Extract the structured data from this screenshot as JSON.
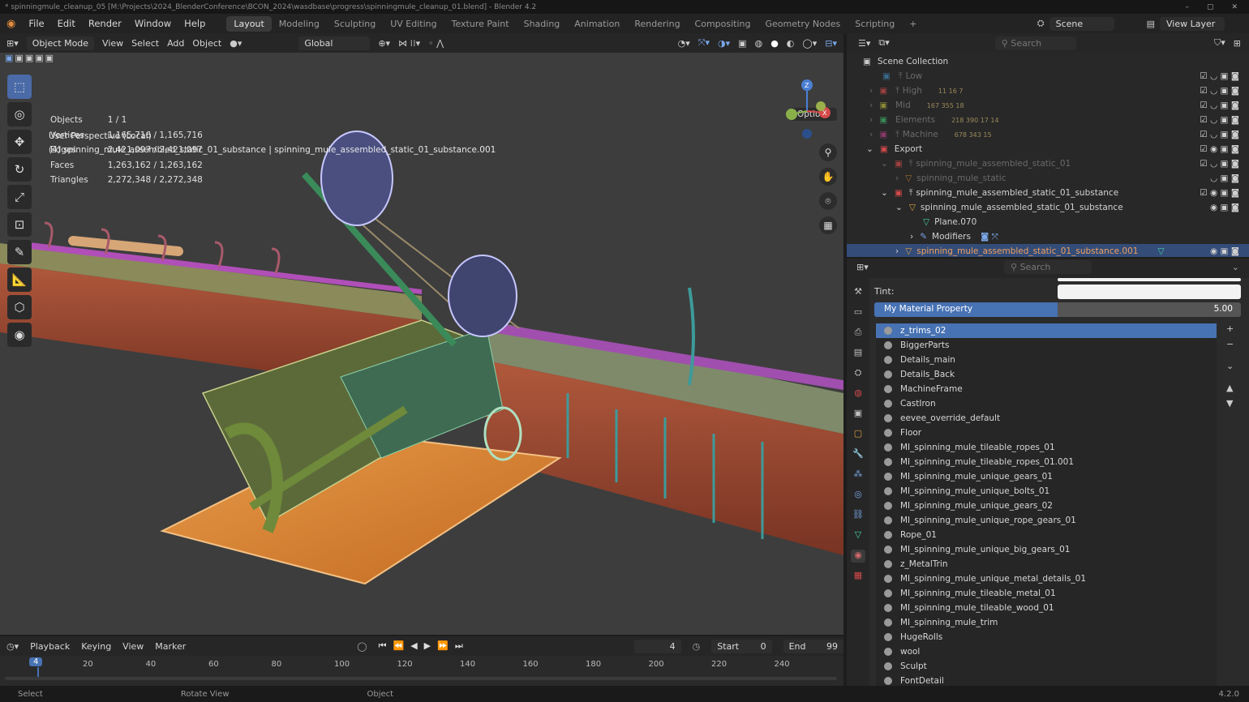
{
  "window": {
    "title": "* spinningmule_cleanup_05 [M:\\Projects\\2024_BlenderConference\\BCON_2024\\wasdbase\\progress\\spinningmule_cleanup_01.blend] - Blender 4.2"
  },
  "menu": [
    "File",
    "Edit",
    "Render",
    "Window",
    "Help"
  ],
  "workspaces": [
    "Layout",
    "Modeling",
    "Sculpting",
    "UV Editing",
    "Texture Paint",
    "Shading",
    "Animation",
    "Rendering",
    "Compositing",
    "Geometry Nodes",
    "Scripting"
  ],
  "active_workspace": "Layout",
  "scene": {
    "name": "Scene",
    "view_layer": "View Layer"
  },
  "viewport_header": {
    "mode": "Object Mode",
    "items": [
      "View",
      "Select",
      "Add",
      "Object"
    ],
    "transform": "Global"
  },
  "viewport": {
    "options": "Options",
    "perspective": "User Perspective (Local)",
    "object_line": "(4) spinning_mule_assembled_static_01_substance | spinning_mule_assembled_static_01_substance.001",
    "stats": [
      {
        "label": "Objects",
        "value": "1 / 1"
      },
      {
        "label": "Vertices",
        "value": "1,165,716 / 1,165,716"
      },
      {
        "label": "Edges",
        "value": "2,421,097 / 2,421,097"
      },
      {
        "label": "Faces",
        "value": "1,263,162 / 1,263,162"
      },
      {
        "label": "Triangles",
        "value": "2,272,348 / 2,272,348"
      }
    ]
  },
  "timeline": {
    "menus": [
      "Playback",
      "Keying",
      "View",
      "Marker"
    ],
    "current_frame": "4",
    "start_label": "Start",
    "start": "0",
    "end_label": "End",
    "end": "99",
    "ticks": [
      "20",
      "40",
      "60",
      "80",
      "100",
      "120",
      "140",
      "160",
      "180",
      "200",
      "220",
      "240"
    ],
    "frame_marker": "4"
  },
  "statusbar": {
    "items": [
      "Select",
      "Rotate View",
      "Object"
    ],
    "version": "4.2.0"
  },
  "outliner": {
    "search_placeholder": "Search",
    "root": "Scene Collection",
    "rows": [
      {
        "name": "Low",
        "extra": "",
        "dim": true
      },
      {
        "name": "High",
        "extra": "11 16 7",
        "dim": true
      },
      {
        "name": "Mid",
        "extra": "167 355 18",
        "dim": true
      },
      {
        "name": "Elements",
        "extra": "218 390 17 14",
        "dim": true
      },
      {
        "name": "Machine",
        "extra": "678 343 15",
        "dim": true
      },
      {
        "name": "Export",
        "extra": "",
        "dim": false
      },
      {
        "name": "spinning_mule_assembled_static_01",
        "extra": "",
        "dim": true
      },
      {
        "name": "spinning_mule_static",
        "extra": "",
        "dim": true
      },
      {
        "name": "spinning_mule_assembled_static_01_substance",
        "extra": "",
        "dim": false
      },
      {
        "name": "spinning_mule_assembled_static_01_substance",
        "extra": "",
        "dim": false
      },
      {
        "name": "Plane.070",
        "extra": "",
        "dim": false
      },
      {
        "name": "Modifiers",
        "extra": "",
        "dim": false
      },
      {
        "name": "spinning_mule_assembled_static_01_substance.001",
        "extra": "",
        "dim": false
      }
    ]
  },
  "properties": {
    "search_placeholder": "Search",
    "tint_label": "Tint:",
    "slider_label": "My Material Property",
    "slider_value": "5.00",
    "slider_fraction": 0.5,
    "materials": [
      "z_trims_02",
      "BiggerParts",
      "Details_main",
      "Details_Back",
      "MachineFrame",
      "CastIron",
      "eevee_override_default",
      "Floor",
      "MI_spinning_mule_tileable_ropes_01",
      "MI_spinning_mule_tileable_ropes_01.001",
      "MI_spinning_mule_unique_gears_01",
      "MI_spinning_mule_unique_bolts_01",
      "MI_spinning_mule_unique_gears_02",
      "MI_spinning_mule_unique_rope_gears_01",
      "Rope_01",
      "MI_spinning_mule_unique_big_gears_01",
      "z_MetalTrin",
      "MI_spinning_mule_unique_metal_details_01",
      "MI_spinning_mule_tileable_metal_01",
      "MI_spinning_mule_tileable_wood_01",
      "MI_spinning_mule_trim",
      "HugeRolls",
      "wool",
      "Sculpt",
      "FontDetail"
    ]
  },
  "colors": {
    "accent": "#4772b3",
    "selection": "#334c78",
    "viewport_bg": "#3d3d3d"
  }
}
